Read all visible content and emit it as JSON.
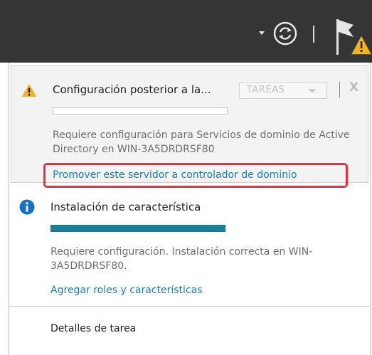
{
  "toolbar": {
    "refresh_icon": "refresh-icon",
    "notifications_icon": "flag-warning-icon"
  },
  "notifications": [
    {
      "icon": "warning-icon",
      "title": "Configuración posterior a la...",
      "tasks_label": "TAREAS",
      "close_label": "X",
      "progress": 0,
      "description": "Requiere configuración para Servicios de dominio de Active Directory en WIN-3A5DRDRSF80",
      "link": "Promover este servidor a controlador de dominio"
    },
    {
      "icon": "info-icon",
      "title": "Instalación de característica",
      "progress": 1.0,
      "description": "Requiere configuración. Instalación correcta en WIN-3A5DRDRSF80.",
      "link": "Agregar roles y características"
    }
  ],
  "footer": {
    "details_label": "Detalles de tarea"
  },
  "colors": {
    "topbar": "#353535",
    "accent": "#1b7e98",
    "link": "#1a7eae",
    "highlight": "#e5323e",
    "warning": "#f4b41a"
  }
}
